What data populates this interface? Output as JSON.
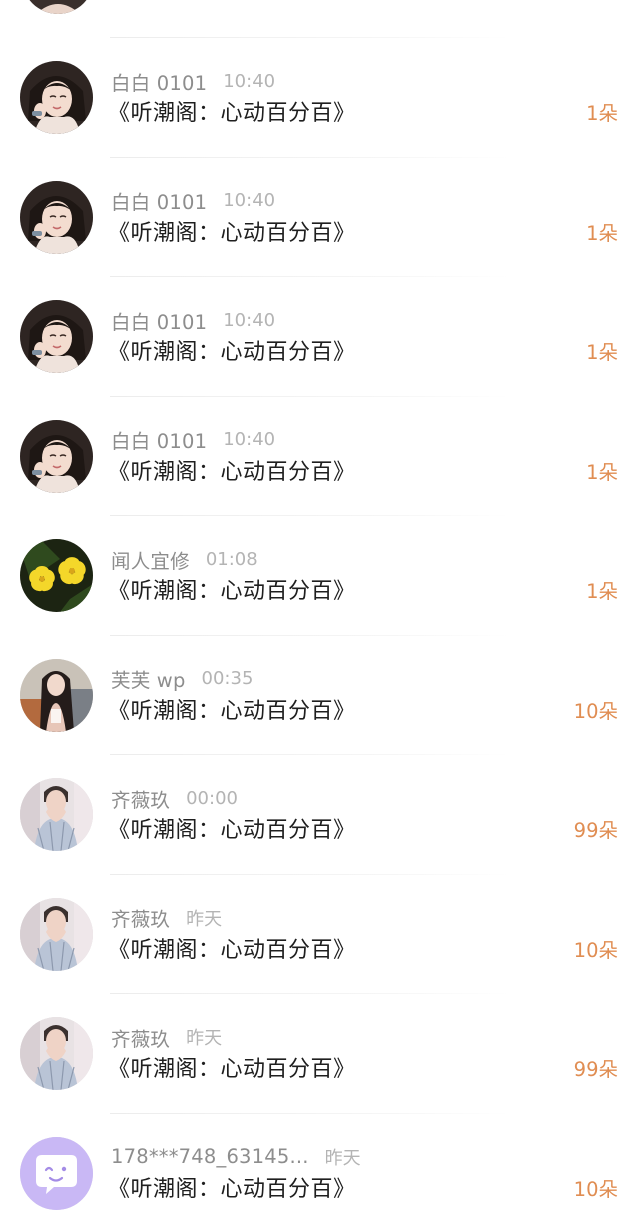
{
  "rows": [
    {
      "name": "白白 0101",
      "time": "10:40",
      "gift": "《听潮阁：心动百分百》",
      "count": "1朵",
      "avatar": "girl-photo-avatar"
    },
    {
      "name": "白白 0101",
      "time": "10:40",
      "gift": "《听潮阁：心动百分百》",
      "count": "1朵",
      "avatar": "girl-photo-avatar"
    },
    {
      "name": "白白 0101",
      "time": "10:40",
      "gift": "《听潮阁：心动百分百》",
      "count": "1朵",
      "avatar": "girl-photo-avatar"
    },
    {
      "name": "白白 0101",
      "time": "10:40",
      "gift": "《听潮阁：心动百分百》",
      "count": "1朵",
      "avatar": "girl-photo-avatar"
    },
    {
      "name": "闻人宜修",
      "time": "01:08",
      "gift": "《听潮阁：心动百分百》",
      "count": "1朵",
      "avatar": "yellow-flower-avatar"
    },
    {
      "name": "芙芙 wp",
      "time": "00:35",
      "gift": "《听潮阁：心动百分百》",
      "count": "10朵",
      "avatar": "long-hair-girl-avatar"
    },
    {
      "name": "齐薇玖",
      "time": "00:00",
      "gift": "《听潮阁：心动百分百》",
      "count": "99朵",
      "avatar": "heart-hands-boy-avatar"
    },
    {
      "name": "齐薇玖",
      "time": "昨天",
      "gift": "《听潮阁：心动百分百》",
      "count": "10朵",
      "avatar": "heart-hands-boy-avatar"
    },
    {
      "name": "齐薇玖",
      "time": "昨天",
      "gift": "《听潮阁：心动百分百》",
      "count": "99朵",
      "avatar": "heart-hands-boy-avatar"
    },
    {
      "name": "178***748_63145...",
      "time": "昨天",
      "gift": "《听潮阁：心动百分百》",
      "count": "10朵",
      "avatar": "default-chat-avatar"
    }
  ],
  "colors": {
    "name": "#8d8d8d",
    "time": "#b4b4b4",
    "gift": "#1f1f1f",
    "count": "#e08d52",
    "default_avatar_bg": "#c9b8f5"
  }
}
